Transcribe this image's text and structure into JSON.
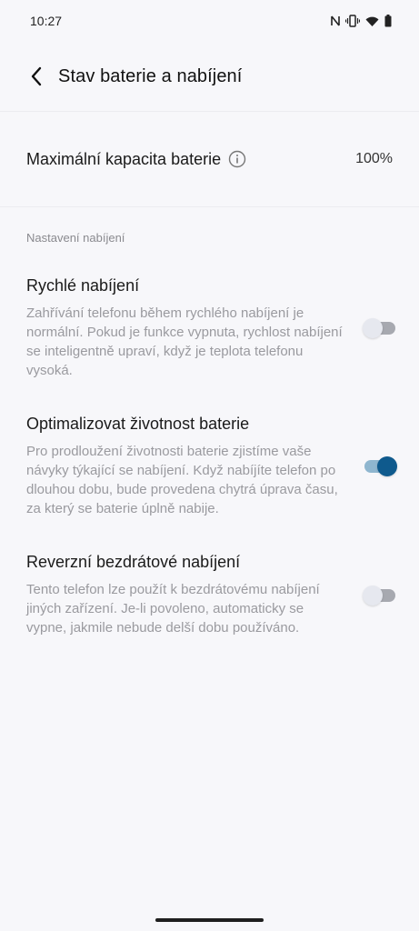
{
  "status_bar": {
    "time": "10:27",
    "icons": [
      "nfc-icon",
      "vibrate-icon",
      "wifi-icon",
      "battery-icon"
    ]
  },
  "header": {
    "title": "Stav baterie a nabíjení"
  },
  "capacity": {
    "label": "Maximální kapacita baterie",
    "value": "100%"
  },
  "section": {
    "label": "Nastavení nabíjení"
  },
  "settings": [
    {
      "title": "Rychlé nabíjení",
      "description": "Zahřívání telefonu během rychlého nabíjení je normální. Pokud je funkce vypnuta, rychlost nabíjení se inteligentně upraví, když je teplota telefonu vysoká.",
      "enabled": false
    },
    {
      "title": "Optimalizovat životnost baterie",
      "description": "Pro prodloužení životnosti baterie zjistíme vaše návyky týkající se nabíjení. Když nabíjíte telefon po dlouhou dobu, bude provedena chytrá úprava času, za který se baterie úplně nabije.",
      "enabled": true
    },
    {
      "title": "Reverzní bezdrátové nabíjení",
      "description": "Tento telefon lze použít k bezdrátovému nabíjení jiných zařízení. Je-li povoleno, automaticky se vypne, jakmile nebude delší dobu používáno.",
      "enabled": false
    }
  ],
  "colors": {
    "accent": "#0f5a8d",
    "background": "#f7f7fa",
    "secondary_text": "#9a9a9f"
  }
}
